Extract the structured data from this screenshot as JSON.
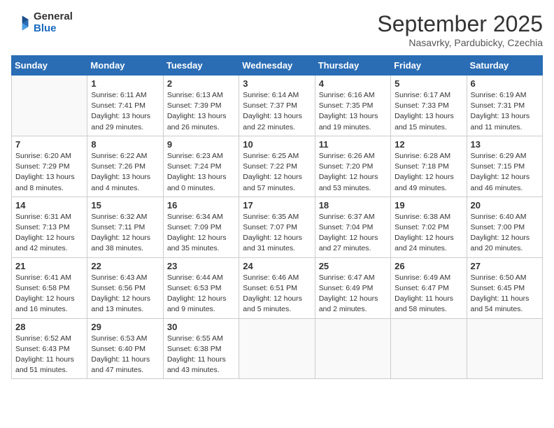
{
  "logo": {
    "general": "General",
    "blue": "Blue"
  },
  "title": "September 2025",
  "subtitle": "Nasavrky, Pardubicky, Czechia",
  "days_header": [
    "Sunday",
    "Monday",
    "Tuesday",
    "Wednesday",
    "Thursday",
    "Friday",
    "Saturday"
  ],
  "weeks": [
    [
      {
        "day": "",
        "info": ""
      },
      {
        "day": "1",
        "info": "Sunrise: 6:11 AM\nSunset: 7:41 PM\nDaylight: 13 hours\nand 29 minutes."
      },
      {
        "day": "2",
        "info": "Sunrise: 6:13 AM\nSunset: 7:39 PM\nDaylight: 13 hours\nand 26 minutes."
      },
      {
        "day": "3",
        "info": "Sunrise: 6:14 AM\nSunset: 7:37 PM\nDaylight: 13 hours\nand 22 minutes."
      },
      {
        "day": "4",
        "info": "Sunrise: 6:16 AM\nSunset: 7:35 PM\nDaylight: 13 hours\nand 19 minutes."
      },
      {
        "day": "5",
        "info": "Sunrise: 6:17 AM\nSunset: 7:33 PM\nDaylight: 13 hours\nand 15 minutes."
      },
      {
        "day": "6",
        "info": "Sunrise: 6:19 AM\nSunset: 7:31 PM\nDaylight: 13 hours\nand 11 minutes."
      }
    ],
    [
      {
        "day": "7",
        "info": "Sunrise: 6:20 AM\nSunset: 7:29 PM\nDaylight: 13 hours\nand 8 minutes."
      },
      {
        "day": "8",
        "info": "Sunrise: 6:22 AM\nSunset: 7:26 PM\nDaylight: 13 hours\nand 4 minutes."
      },
      {
        "day": "9",
        "info": "Sunrise: 6:23 AM\nSunset: 7:24 PM\nDaylight: 13 hours\nand 0 minutes."
      },
      {
        "day": "10",
        "info": "Sunrise: 6:25 AM\nSunset: 7:22 PM\nDaylight: 12 hours\nand 57 minutes."
      },
      {
        "day": "11",
        "info": "Sunrise: 6:26 AM\nSunset: 7:20 PM\nDaylight: 12 hours\nand 53 minutes."
      },
      {
        "day": "12",
        "info": "Sunrise: 6:28 AM\nSunset: 7:18 PM\nDaylight: 12 hours\nand 49 minutes."
      },
      {
        "day": "13",
        "info": "Sunrise: 6:29 AM\nSunset: 7:15 PM\nDaylight: 12 hours\nand 46 minutes."
      }
    ],
    [
      {
        "day": "14",
        "info": "Sunrise: 6:31 AM\nSunset: 7:13 PM\nDaylight: 12 hours\nand 42 minutes."
      },
      {
        "day": "15",
        "info": "Sunrise: 6:32 AM\nSunset: 7:11 PM\nDaylight: 12 hours\nand 38 minutes."
      },
      {
        "day": "16",
        "info": "Sunrise: 6:34 AM\nSunset: 7:09 PM\nDaylight: 12 hours\nand 35 minutes."
      },
      {
        "day": "17",
        "info": "Sunrise: 6:35 AM\nSunset: 7:07 PM\nDaylight: 12 hours\nand 31 minutes."
      },
      {
        "day": "18",
        "info": "Sunrise: 6:37 AM\nSunset: 7:04 PM\nDaylight: 12 hours\nand 27 minutes."
      },
      {
        "day": "19",
        "info": "Sunrise: 6:38 AM\nSunset: 7:02 PM\nDaylight: 12 hours\nand 24 minutes."
      },
      {
        "day": "20",
        "info": "Sunrise: 6:40 AM\nSunset: 7:00 PM\nDaylight: 12 hours\nand 20 minutes."
      }
    ],
    [
      {
        "day": "21",
        "info": "Sunrise: 6:41 AM\nSunset: 6:58 PM\nDaylight: 12 hours\nand 16 minutes."
      },
      {
        "day": "22",
        "info": "Sunrise: 6:43 AM\nSunset: 6:56 PM\nDaylight: 12 hours\nand 13 minutes."
      },
      {
        "day": "23",
        "info": "Sunrise: 6:44 AM\nSunset: 6:53 PM\nDaylight: 12 hours\nand 9 minutes."
      },
      {
        "day": "24",
        "info": "Sunrise: 6:46 AM\nSunset: 6:51 PM\nDaylight: 12 hours\nand 5 minutes."
      },
      {
        "day": "25",
        "info": "Sunrise: 6:47 AM\nSunset: 6:49 PM\nDaylight: 12 hours\nand 2 minutes."
      },
      {
        "day": "26",
        "info": "Sunrise: 6:49 AM\nSunset: 6:47 PM\nDaylight: 11 hours\nand 58 minutes."
      },
      {
        "day": "27",
        "info": "Sunrise: 6:50 AM\nSunset: 6:45 PM\nDaylight: 11 hours\nand 54 minutes."
      }
    ],
    [
      {
        "day": "28",
        "info": "Sunrise: 6:52 AM\nSunset: 6:43 PM\nDaylight: 11 hours\nand 51 minutes."
      },
      {
        "day": "29",
        "info": "Sunrise: 6:53 AM\nSunset: 6:40 PM\nDaylight: 11 hours\nand 47 minutes."
      },
      {
        "day": "30",
        "info": "Sunrise: 6:55 AM\nSunset: 6:38 PM\nDaylight: 11 hours\nand 43 minutes."
      },
      {
        "day": "",
        "info": ""
      },
      {
        "day": "",
        "info": ""
      },
      {
        "day": "",
        "info": ""
      },
      {
        "day": "",
        "info": ""
      }
    ]
  ]
}
